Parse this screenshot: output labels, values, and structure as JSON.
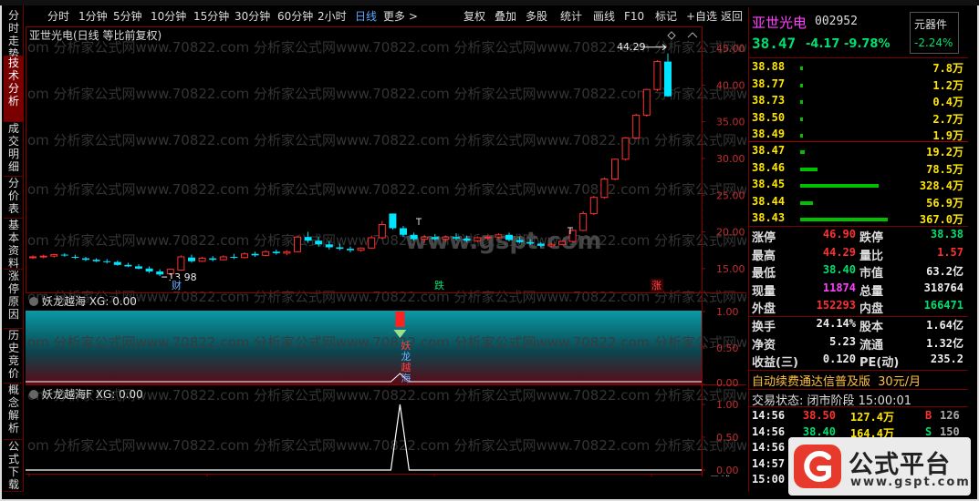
{
  "toolbar": {
    "items": [
      "分时",
      "1分钟",
      "5分钟",
      "10分钟",
      "15分钟",
      "30分钟",
      "60分钟",
      "2小时",
      "日线",
      "更多 >",
      "复权",
      "叠加",
      "多股",
      "统计",
      "画线",
      "F10",
      "标记",
      "+自选",
      "返回"
    ],
    "active": "日线"
  },
  "left_tabs": [
    "分时走势",
    "技术分析",
    "成交明细",
    "分价表",
    "基本资料",
    "涨停原因",
    "历史竞价",
    "概念解析",
    "公式下载"
  ],
  "left_tabs_active": "技术分析",
  "chart": {
    "title": "亚世光电(日线 等比前复权)",
    "annot_high": "44.29",
    "annot_low": "13.98",
    "markers": [
      "财",
      "跌",
      "涨"
    ],
    "indicator1_title": "妖龙越海  XG: 0.00",
    "indicator2_title": "妖龙越海F  XG: 0.00",
    "ind1_words": [
      "妖",
      "龙",
      "越",
      "海"
    ],
    "x_labels": [
      "2023年",
      "11",
      "12",
      "1"
    ],
    "period_label": "日线",
    "watermark_site": "www.gspt.com",
    "watermark_text": "om 分析家公式网www.70822.com 分析家公式网www.70822.com 分析家公式网www.70822.com 分析家公式网www.70822.com"
  },
  "chart_data": [
    {
      "type": "candlestick",
      "yticks": [
        "45.00",
        "40.00",
        "35.00",
        "30.00",
        "25.00",
        "20.00",
        "15.00"
      ],
      "ylim": [
        12.5,
        46.5
      ],
      "candles": [
        [
          16.5,
          16.8,
          16.3,
          16.6
        ],
        [
          16.6,
          16.9,
          16.4,
          16.7
        ],
        [
          16.7,
          17.0,
          16.5,
          16.9
        ],
        [
          16.9,
          17.1,
          16.6,
          16.8
        ],
        [
          16.6,
          16.9,
          16.3,
          16.5
        ],
        [
          16.4,
          16.6,
          16.0,
          16.2
        ],
        [
          16.2,
          16.4,
          15.9,
          16.0
        ],
        [
          16.0,
          16.3,
          15.7,
          15.9
        ],
        [
          15.9,
          16.1,
          15.4,
          15.5
        ],
        [
          15.5,
          15.8,
          15.2,
          15.3
        ],
        [
          15.3,
          15.6,
          14.9,
          15.0
        ],
        [
          15.0,
          15.3,
          14.4,
          14.6
        ],
        [
          14.6,
          14.9,
          13.98,
          14.2
        ],
        [
          14.3,
          15.0,
          14.1,
          14.9
        ],
        [
          14.8,
          16.8,
          14.7,
          16.6
        ],
        [
          16.5,
          16.9,
          15.8,
          16.0
        ],
        [
          16.0,
          16.6,
          15.9,
          16.4
        ],
        [
          16.4,
          16.7,
          16.0,
          16.2
        ],
        [
          16.2,
          16.8,
          16.1,
          16.6
        ],
        [
          16.6,
          17.0,
          16.3,
          16.5
        ],
        [
          16.5,
          17.2,
          16.4,
          17.0
        ],
        [
          17.0,
          17.3,
          16.6,
          16.8
        ],
        [
          16.8,
          17.5,
          16.7,
          17.3
        ],
        [
          17.3,
          17.6,
          16.9,
          17.1
        ],
        [
          17.1,
          17.5,
          16.8,
          17.3
        ],
        [
          17.3,
          19.5,
          17.2,
          19.3
        ],
        [
          19.3,
          20.0,
          18.5,
          18.8
        ],
        [
          18.8,
          19.3,
          18.0,
          18.3
        ],
        [
          18.3,
          18.8,
          17.6,
          17.9
        ],
        [
          17.9,
          18.4,
          17.5,
          17.7
        ],
        [
          17.7,
          18.0,
          17.2,
          17.5
        ],
        [
          17.5,
          17.9,
          17.3,
          17.8
        ],
        [
          17.8,
          19.5,
          17.7,
          19.2
        ],
        [
          19.2,
          21.5,
          19.0,
          21.0
        ],
        [
          22.5,
          22.5,
          20.3,
          20.5
        ],
        [
          20.5,
          20.8,
          19.3,
          19.6
        ],
        [
          19.6,
          19.9,
          18.8,
          19.0
        ],
        [
          19.0,
          19.6,
          18.5,
          19.3
        ],
        [
          19.3,
          19.7,
          18.8,
          19.0
        ],
        [
          19.0,
          19.5,
          18.7,
          19.3
        ],
        [
          19.3,
          19.8,
          18.8,
          19.1
        ],
        [
          19.1,
          19.5,
          18.6,
          18.8
        ],
        [
          18.8,
          19.4,
          18.6,
          19.2
        ],
        [
          19.2,
          19.6,
          18.9,
          19.3
        ],
        [
          19.3,
          19.8,
          19.0,
          19.6
        ],
        [
          19.6,
          19.9,
          18.7,
          18.9
        ],
        [
          18.9,
          19.3,
          18.4,
          18.6
        ],
        [
          18.6,
          19.0,
          18.2,
          18.4
        ],
        [
          18.4,
          18.6,
          17.9,
          18.1
        ],
        [
          18.1,
          18.5,
          17.9,
          18.3
        ],
        [
          18.3,
          18.8,
          18.2,
          18.7
        ],
        [
          18.7,
          20.4,
          18.6,
          20.2
        ],
        [
          20.2,
          22.8,
          20.1,
          22.5
        ],
        [
          22.5,
          24.9,
          22.3,
          24.7
        ],
        [
          24.7,
          27.4,
          24.5,
          27.2
        ],
        [
          27.2,
          30.0,
          27.0,
          29.9
        ],
        [
          29.9,
          32.9,
          29.7,
          32.8
        ],
        [
          32.8,
          36.1,
          32.6,
          35.9
        ],
        [
          35.9,
          39.5,
          35.7,
          39.4
        ],
        [
          39.4,
          43.4,
          39.2,
          43.2
        ],
        [
          43.2,
          44.29,
          38.4,
          38.47
        ]
      ]
    },
    {
      "type": "line",
      "name": "妖龙越海F",
      "yticks": [
        "1.00",
        "0.50",
        "0.00"
      ],
      "ylim": [
        0,
        1.1
      ],
      "spike_index": 34,
      "spike_value": 1.0
    }
  ],
  "stock": {
    "name": "亚世光电",
    "code": "002952",
    "sector_btn": "元器件",
    "price": "38.47",
    "change": "-4.17",
    "change_pct": "-9.78%",
    "sector_pct": "-2.24%"
  },
  "asks": [
    {
      "price": "38.88",
      "vol": "7.8万",
      "bar": 0
    },
    {
      "price": "38.77",
      "vol": "1.2万",
      "bar": 0
    },
    {
      "price": "38.73",
      "vol": "0.4万",
      "bar": 0
    },
    {
      "price": "38.50",
      "vol": "2.7万",
      "bar": 0
    },
    {
      "price": "38.49",
      "vol": "1.9万",
      "bar": 0
    }
  ],
  "bids": [
    {
      "price": "38.47",
      "vol": "19.2万",
      "bar": 0.05
    },
    {
      "price": "38.46",
      "vol": "78.5万",
      "bar": 0.2
    },
    {
      "price": "38.45",
      "vol": "328.4万",
      "bar": 0.9
    },
    {
      "price": "38.44",
      "vol": "56.9万",
      "bar": 0.15
    },
    {
      "price": "38.43",
      "vol": "367.0万",
      "bar": 1.0
    }
  ],
  "stats": [
    {
      "l1": "涨停",
      "v1": "46.90",
      "c1": "red",
      "l2": "跌停",
      "v2": "38.38",
      "c2": "green"
    },
    {
      "l1": "最高",
      "v1": "44.29",
      "c1": "red",
      "l2": "量比",
      "v2": "1.57",
      "c2": "red"
    },
    {
      "l1": "最低",
      "v1": "38.40",
      "c1": "green",
      "l2": "市值",
      "v2": "63.2亿",
      "c2": "white"
    },
    {
      "l1": "现量",
      "v1": "11874",
      "c1": "magenta",
      "l2": "总量",
      "v2": "318764",
      "c2": "white"
    },
    {
      "l1": "外盘",
      "v1": "152293",
      "c1": "red",
      "l2": "内盘",
      "v2": "166471",
      "c2": "green"
    }
  ],
  "stats2": [
    {
      "l1": "换手",
      "v1": "24.14%",
      "l2": "股本",
      "v2": "1.64亿"
    },
    {
      "l1": "净资",
      "v1": "5.23",
      "l2": "流通",
      "v2": "1.32亿"
    },
    {
      "l1": "收益(三)",
      "v1": "0.120",
      "l2": "PE(动)",
      "v2": "235.2"
    }
  ],
  "promo": {
    "text": "自动续费通达信普及版",
    "price": "30元/月"
  },
  "trade_state": "交易状态: 闭市阶段 15:00:01",
  "ticks": [
    {
      "time": "14:56",
      "price": "38.50",
      "vol": "127.4万",
      "side": "B",
      "num": "126"
    },
    {
      "time": "14:56",
      "price": "38.40",
      "vol": "164.4万",
      "side": "S",
      "num": "150"
    },
    {
      "time": "14:56",
      "price": "",
      "vol": "",
      "side": "",
      "num": ""
    },
    {
      "time": "14:57",
      "price": "",
      "vol": "",
      "side": "",
      "num": ""
    },
    {
      "time": "15:00",
      "price": "",
      "vol": "",
      "side": "",
      "num": ""
    }
  ],
  "logo": {
    "name": "公式平台",
    "url": "www.gspt.com"
  },
  "colors": {
    "up": "#ff3030",
    "down": "#00e5ff",
    "accent_blue": "#5aa8ff",
    "panel_border": "#700000"
  }
}
